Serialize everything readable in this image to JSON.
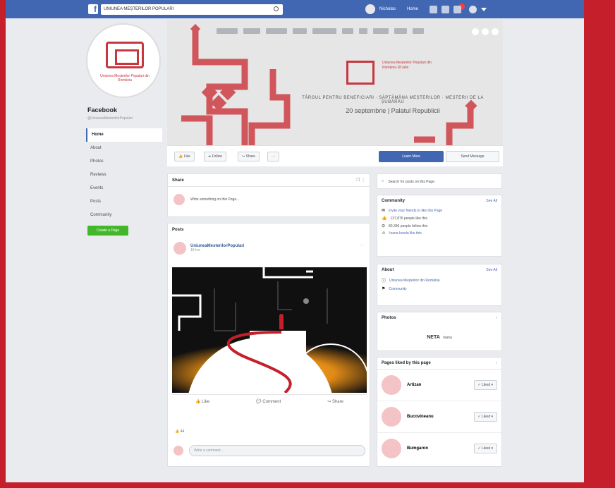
{
  "topbar": {
    "search_text": "UNIUNEA MEȘTERILOR POPULARI",
    "user_name": "Nicholas",
    "home_label": "Home"
  },
  "page": {
    "name": "Facebook",
    "handle": "@UniuneaMesterilorPopulari",
    "logo_caption": "Uniunea Meșterilor Populari din România"
  },
  "nav": {
    "items": [
      "Home",
      "About",
      "Photos",
      "Reviews",
      "Events",
      "Posts",
      "Community"
    ],
    "create_label": "Create a Page"
  },
  "cover": {
    "logo_text": "Uniunea Meșterilor Populari din România 28 iulie",
    "line1": "TÂRGUL PENTRU BENEFICIARI · SĂPTĂMÂNA MEȘTERILOR · MEȘTERII DE LA ȘUBĂRĂU",
    "line2": "20 septembrie | Palatul Republicii"
  },
  "action_bar": {
    "like": "Like",
    "follow": "Follow",
    "share": "Share",
    "more": "···",
    "learn_more": "Learn More",
    "send_message": "Send Message"
  },
  "create_post": {
    "title": "Share",
    "placeholder": "Write something on this Page..."
  },
  "posts": {
    "heading": "Posts",
    "author": "UniuneaMesterilorPopulari",
    "time": "18 hrs",
    "like": "Like",
    "comment": "Comment",
    "share": "Share",
    "reaction_count": "44",
    "comment_placeholder": "Write a comment..."
  },
  "right": {
    "search_placeholder": "Search for posts on this Page",
    "community": {
      "title": "Community",
      "see_all": "See All",
      "items": [
        "Invite your friends to like this Page",
        "137,876 people like this",
        "80,396 people follow this",
        "Ioana Ionela like this"
      ]
    },
    "about": {
      "title": "About",
      "see_all": "See All",
      "items": [
        "Uniunea Meșterilor din România",
        "Community"
      ]
    },
    "photos": {
      "title": "Photos",
      "label": "NETA",
      "sub": "Ioana"
    },
    "liked": {
      "title": "Pages liked by this page",
      "items": [
        {
          "name": "Artizan",
          "action": "Liked"
        },
        {
          "name": "Bucovineanu",
          "action": "Liked"
        },
        {
          "name": "Bumgaron",
          "action": "Liked"
        }
      ]
    }
  }
}
